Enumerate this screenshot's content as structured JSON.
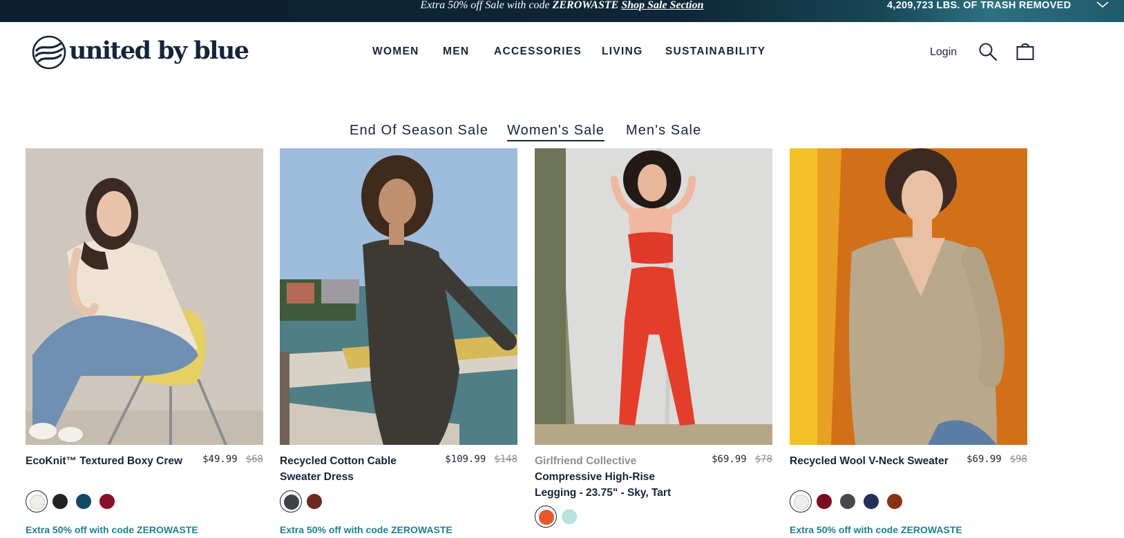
{
  "announcement": {
    "prefix": "Extra 50% off Sale with code ",
    "code": "ZEROWASTE",
    "link": "Shop Sale Section",
    "trash_counter": "4,209,723 LBS. OF TRASH REMOVED",
    "chevron_icon": "chevron-down-icon"
  },
  "header": {
    "logo_text": "united by blue",
    "nav": [
      "WOMEN",
      "MEN",
      "ACCESSORIES",
      "LIVING",
      "SUSTAINABILITY"
    ],
    "login": "Login",
    "icons": {
      "search": "search-icon",
      "cart": "shopping-bag-icon"
    }
  },
  "tabs": [
    {
      "label": "End Of Season Sale",
      "active": false
    },
    {
      "label": "Women's Sale",
      "active": true
    },
    {
      "label": "Men's Sale",
      "active": false
    }
  ],
  "colors": {
    "navy": "#14253a",
    "teal_offer": "#1c7f8e",
    "muted": "#8a9099"
  },
  "products": [
    {
      "brand": "",
      "name": "EcoKnit™ Textured Boxy Crew",
      "price": "$49.99",
      "compare_price": "$68",
      "swatches": [
        "#efeee8",
        "#222222",
        "#124a66",
        "#8b0e2a"
      ],
      "selected_swatch": 0,
      "offer": "Extra 50% off with code ZEROWASTE"
    },
    {
      "brand": "",
      "name": "Recycled Cotton Cable Sweater Dress",
      "price": "$109.99",
      "compare_price": "$148",
      "swatches": [
        "#3e4145",
        "#6b2a20"
      ],
      "selected_swatch": 0,
      "offer": "Extra 50% off with code ZEROWASTE"
    },
    {
      "brand": "Girlfriend Collective",
      "name": "Compressive High-Rise Legging - 23.75\" - Sky, Tart",
      "price": "$69.99",
      "compare_price": "$78",
      "swatches": [
        "#e8582e",
        "#b7e2dd"
      ],
      "selected_swatch": 0,
      "offer": ""
    },
    {
      "brand": "",
      "name": "Recycled Wool V-Neck Sweater",
      "price": "$69.99",
      "compare_price": "$98",
      "swatches": [
        "#efeee8",
        "#7e0b1f",
        "#45484c",
        "#252f5a",
        "#8a3115"
      ],
      "selected_swatch": 0,
      "offer": "Extra 50% off with code ZEROWASTE"
    }
  ]
}
